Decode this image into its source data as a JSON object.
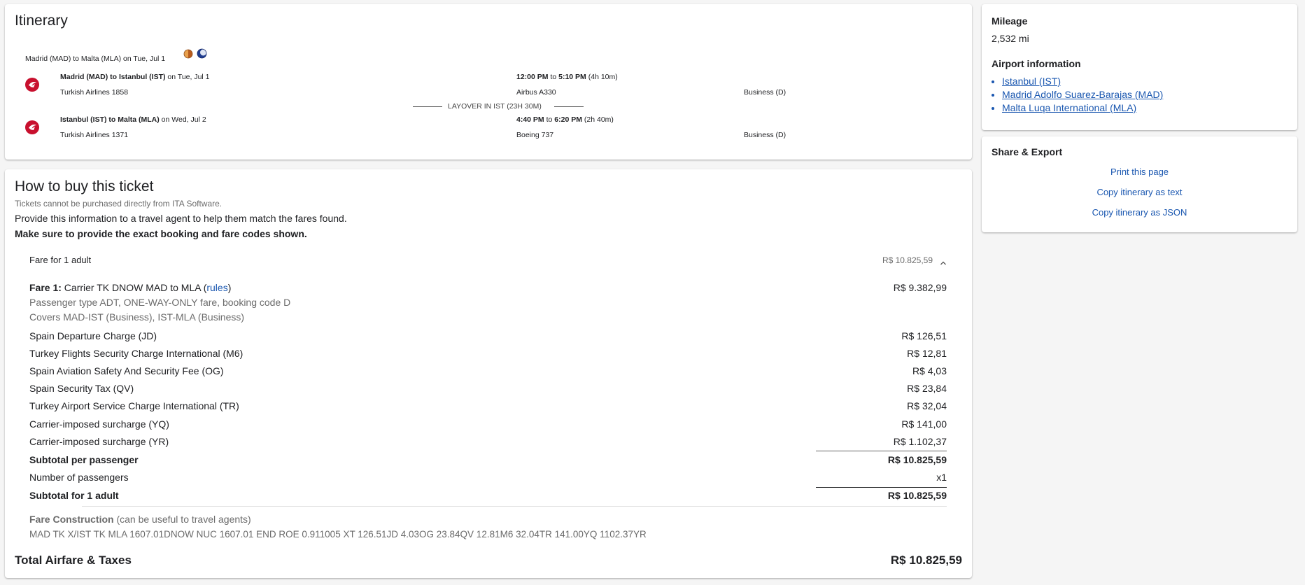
{
  "itinerary": {
    "title": "Itinerary",
    "route_summary": "Madrid (MAD) to Malta (MLA) on Tue, Jul 1",
    "segments": [
      {
        "route_bold": "Madrid (MAD) to Istanbul (IST)",
        "date_text": " on Tue, Jul 1",
        "flight": "Turkish Airlines 1858",
        "time_bold": "12:00 PM",
        "to_word": " to ",
        "time_bold_end": "5:10 PM",
        "duration": " (4h 10m)",
        "aircraft": "Airbus A330",
        "cabin": "Business (D)"
      },
      {
        "route_bold": "Istanbul (IST) to Malta (MLA)",
        "date_text": " on Wed, Jul 2",
        "flight": "Turkish Airlines 1371",
        "time_bold": "4:40 PM",
        "to_word": " to ",
        "time_bold_end": "6:20 PM",
        "duration": " (2h 40m)",
        "aircraft": "Boeing 737",
        "cabin": "Business (D)"
      }
    ],
    "layover": "LAYOVER IN IST (23H 30M)"
  },
  "buy": {
    "title": "How to buy this ticket",
    "note": "Tickets cannot be purchased directly from ITA Software.",
    "instruction": "Provide this information to a travel agent to help them match the fares found.",
    "warning": "Make sure to provide the exact booking and fare codes shown.",
    "fare_header_label": "Fare for 1 adult",
    "fare_header_amount": "R$ 10.825,59",
    "fare1_label": "Fare 1:",
    "fare1_text": " Carrier TK DNOW MAD to MLA (",
    "fare1_rules": "rules",
    "fare1_close": ")",
    "fare1_amount": "R$ 9.382,99",
    "fare1_detail1": "Passenger type ADT, ONE-WAY-ONLY fare, booking code D",
    "fare1_detail2": "Covers MAD-IST (Business), IST-MLA (Business)",
    "charges": [
      {
        "label": "Spain Departure Charge (JD)",
        "amount": "R$ 126,51"
      },
      {
        "label": "Turkey Flights Security Charge International (M6)",
        "amount": "R$ 12,81"
      },
      {
        "label": "Spain Aviation Safety And Security Fee (OG)",
        "amount": "R$ 4,03"
      },
      {
        "label": "Spain Security Tax (QV)",
        "amount": "R$ 23,84"
      },
      {
        "label": "Turkey Airport Service Charge International (TR)",
        "amount": "R$ 32,04"
      },
      {
        "label": "Carrier-imposed surcharge (YQ)",
        "amount": "R$ 141,00"
      },
      {
        "label": "Carrier-imposed surcharge (YR)",
        "amount": "R$ 1.102,37"
      }
    ],
    "subtotal_pp_label": "Subtotal per passenger",
    "subtotal_pp_amount": "R$ 10.825,59",
    "passengers_label": "Number of passengers",
    "passengers_value": "x1",
    "subtotal_adult_label": "Subtotal for 1 adult",
    "subtotal_adult_amount": "R$ 10.825,59",
    "fc_label": "Fare Construction",
    "fc_note": " (can be useful to travel agents)",
    "fc_text": "MAD TK X/IST TK MLA 1607.01DNOW NUC 1607.01 END ROE 0.911005 XT 126.51JD 4.03OG 23.84QV 12.81M6 32.04TR 141.00YQ 1102.37YR",
    "total_label": "Total Airfare & Taxes",
    "total_amount": "R$ 10.825,59"
  },
  "sidebar": {
    "mileage_title": "Mileage",
    "mileage_value": "2,532 mi",
    "airport_title": "Airport information",
    "airports": [
      "Istanbul (IST)",
      "Madrid Adolfo Suarez-Barajas (MAD)",
      "Malta Luqa International (MLA)"
    ],
    "share_title": "Share & Export",
    "share_links": [
      "Print this page",
      "Copy itinerary as text",
      "Copy itinerary as JSON"
    ]
  },
  "colors": {
    "link": "#1a57b0",
    "airline_red": "#c8102e",
    "background": "#f5f5f5"
  },
  "icons": [
    "turkish-airlines-logo",
    "sunrise-icon",
    "night-icon",
    "chevron-up-icon"
  ]
}
